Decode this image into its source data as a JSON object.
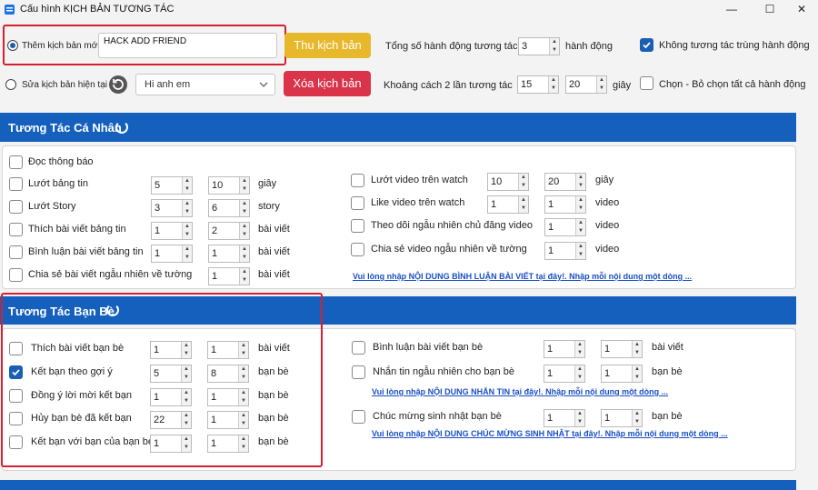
{
  "window": {
    "title": "Cấu hình KỊCH BẢN TƯƠNG TÁC",
    "minimize": "—",
    "maximize": "☐",
    "close": "✕"
  },
  "top": {
    "new_script_label": "Thêm kịch bản mới",
    "new_script_value": "HACK ADD FRIEND",
    "collapse_btn": "Thu kịch bản",
    "edit_script_label": "Sửa kịch bản hiện tại",
    "script_select": "Hi anh em",
    "delete_btn": "Xóa kịch bản",
    "total_actions_label": "Tổng số hành động tương tác",
    "total_actions_value": "3",
    "total_actions_unit": "hành động",
    "interval_label": "Khoảng cách 2 lần tương tác",
    "interval_from": "15",
    "interval_to": "20",
    "interval_unit": "giây",
    "no_dup_label": "Không tương tác trùng hành động",
    "select_all_label": "Chọn - Bỏ chọn tất cả hành động"
  },
  "personal": {
    "title": "Tương Tác Cá Nhân",
    "notif": "Đọc thông báo",
    "left": [
      {
        "label": "Lướt bảng tin",
        "a": "5",
        "b": "10",
        "unit": "giây"
      },
      {
        "label": "Lướt Story",
        "a": "3",
        "b": "6",
        "unit": "story"
      },
      {
        "label": "Thích bài viết bảng tin",
        "a": "1",
        "b": "2",
        "unit": "bài viết"
      },
      {
        "label": "Bình luận bài viết bảng tin",
        "a": "1",
        "b": "1",
        "unit": "bài viết"
      },
      {
        "label": "Chia sẻ bài viết ngẫu nhiên về tường",
        "b": "1",
        "unit": "bài viết"
      }
    ],
    "right": [
      {
        "label": "Lướt video trên watch",
        "a": "10",
        "b": "20",
        "unit": "giây"
      },
      {
        "label": "Like video trên watch",
        "a": "1",
        "b": "1",
        "unit": "video"
      },
      {
        "label": "Theo dõi ngẫu nhiên chủ đăng video",
        "b": "1",
        "unit": "video"
      },
      {
        "label": "Chia sẻ video ngẫu nhiên về tường",
        "b": "1",
        "unit": "video"
      }
    ],
    "link": "Vui lòng nhập NỘI DUNG BÌNH LUẬN BÀI VIẾT tại đây!. Nhập mỗi nội dung một dòng ..."
  },
  "friends": {
    "title": "Tương Tác Bạn Bè",
    "left": [
      {
        "label": "Thích bài viết bạn bè",
        "a": "1",
        "b": "1",
        "unit": "bài viết",
        "checked": false
      },
      {
        "label": "Kết bạn theo gợi ý",
        "a": "5",
        "b": "8",
        "unit": "bạn bè",
        "checked": true
      },
      {
        "label": "Đồng ý lời mời kết bạn",
        "a": "1",
        "b": "1",
        "unit": "bạn bè",
        "checked": false
      },
      {
        "label": "Hủy bạn bè đã kết bạn",
        "a": "22",
        "b": "1",
        "unit": "bạn bè",
        "checked": false
      },
      {
        "label": "Kết bạn với bạn của bạn bè",
        "a": "1",
        "b": "1",
        "unit": "bạn bè",
        "checked": false
      }
    ],
    "right": [
      {
        "label": "Bình luận bài viết bạn bè",
        "a": "1",
        "b": "1",
        "unit": "bài viết"
      },
      {
        "label": "Nhắn tin ngẫu nhiên cho bạn bè",
        "a": "1",
        "b": "1",
        "unit": "bạn bè"
      },
      {
        "label": "Chúc mừng sinh nhật bạn bè",
        "a": "1",
        "b": "1",
        "unit": "bạn bè"
      }
    ],
    "link_msg": "Vui lòng nhập NỘI DUNG NHẮN TIN tại đây!. Nhập mỗi nội dung một dòng ...",
    "link_bday": "Vui lòng nhập NỘI DUNG CHÚC MỪNG SINH NHẬT tại đây!. Nhập mỗi nội dung một dòng ..."
  },
  "colors": {
    "accent": "#1560bd",
    "highlight": "#d42030",
    "yellow_btn": "#e8b82c",
    "red_btn": "#d9344a"
  }
}
